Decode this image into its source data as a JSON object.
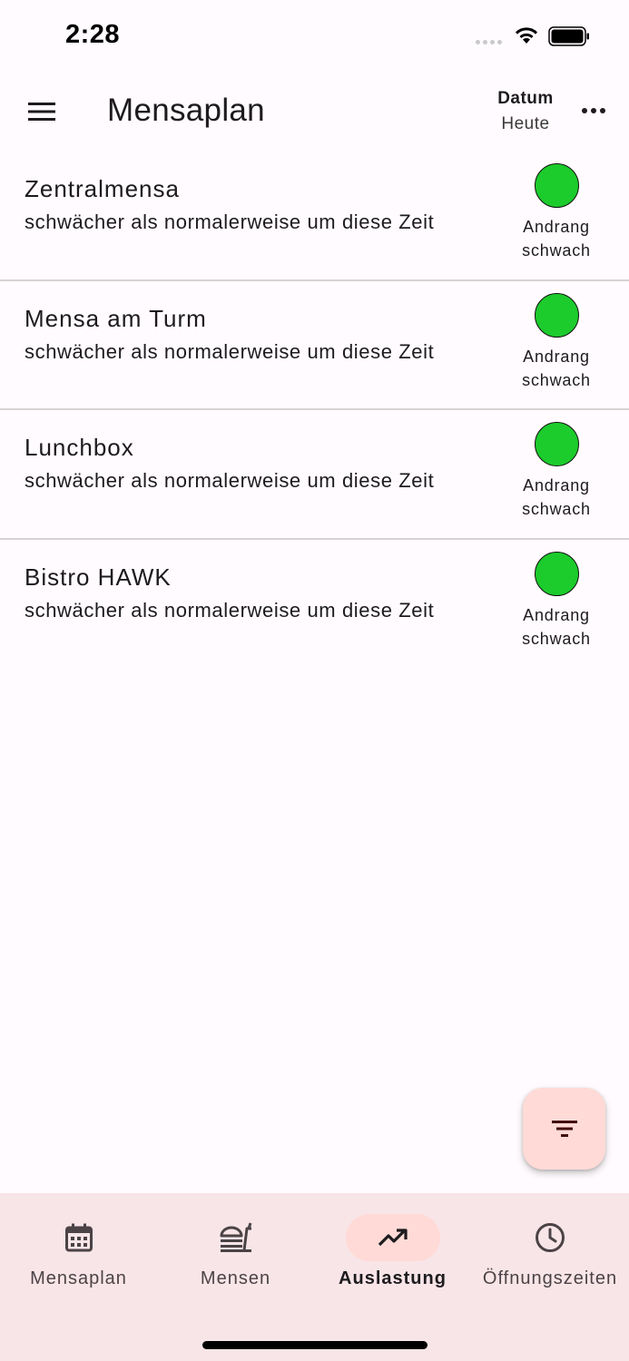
{
  "status_bar": {
    "time": "2:28",
    "icons": [
      "signal-icon",
      "wifi-icon",
      "battery-icon"
    ]
  },
  "app_bar": {
    "menu_icon": "menu-icon",
    "title": "Mensaplan",
    "date_label": "Datum",
    "date_value": "Heute",
    "more_icon": "more-horizontal-icon"
  },
  "canteens": [
    {
      "name": "Zentralmensa",
      "status": "schwächer als normalerweise um diese Zeit",
      "crowd_line1": "Andrang",
      "crowd_line2": "schwach",
      "indicator_color": "#1ccb2c"
    },
    {
      "name": "Mensa am Turm",
      "status": "schwächer als normalerweise um diese Zeit",
      "crowd_line1": "Andrang",
      "crowd_line2": "schwach",
      "indicator_color": "#1ccb2c"
    },
    {
      "name": "Lunchbox",
      "status": "schwächer als normalerweise um diese Zeit",
      "crowd_line1": "Andrang",
      "crowd_line2": "schwach",
      "indicator_color": "#1ccb2c"
    },
    {
      "name": "Bistro HAWK",
      "status": "schwächer als normalerweise um diese Zeit",
      "crowd_line1": "Andrang",
      "crowd_line2": "schwach",
      "indicator_color": "#1ccb2c"
    }
  ],
  "fab": {
    "icon": "filter-icon"
  },
  "bottom_nav": {
    "items": [
      {
        "label": "Mensaplan",
        "icon": "calendar-icon",
        "active": false
      },
      {
        "label": "Mensen",
        "icon": "restaurant-icon",
        "active": false
      },
      {
        "label": "Auslastung",
        "icon": "trending-up-icon",
        "active": true
      },
      {
        "label": "Öffnungszeiten",
        "icon": "clock-icon",
        "active": false
      }
    ]
  },
  "colors": {
    "background": "#fffbfe",
    "accent_container": "#ffdad6",
    "nav_background": "#f8e5e8",
    "indicator_green": "#1ccb2c"
  }
}
